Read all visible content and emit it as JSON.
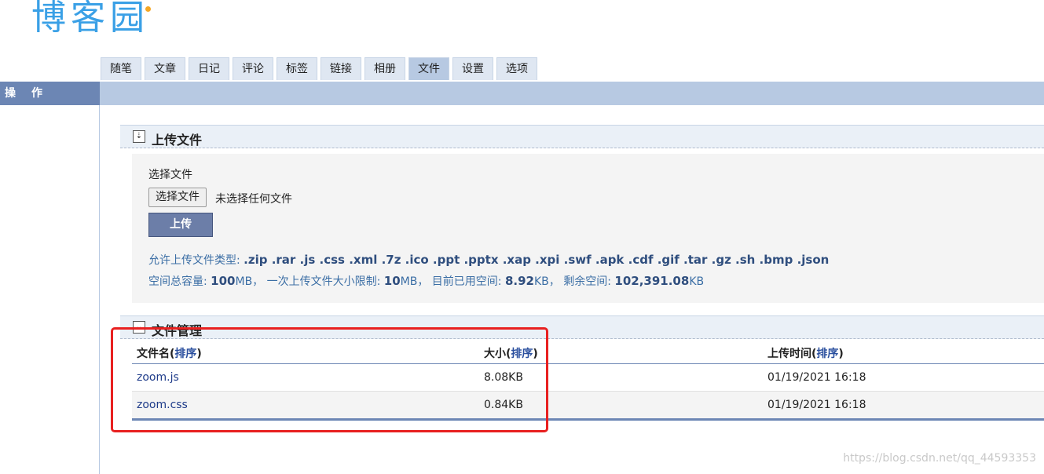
{
  "logo": {
    "text": "博客园"
  },
  "tabs": [
    {
      "label": "随笔"
    },
    {
      "label": "文章"
    },
    {
      "label": "日记"
    },
    {
      "label": "评论"
    },
    {
      "label": "标签"
    },
    {
      "label": "链接"
    },
    {
      "label": "相册"
    },
    {
      "label": "文件"
    },
    {
      "label": "设置"
    },
    {
      "label": "选项"
    }
  ],
  "active_tab": "文件",
  "sidebar": {
    "title": "操作"
  },
  "upload": {
    "section_title": "上传文件",
    "toggle_icon": "double-chevron-down",
    "field_label": "选择文件",
    "choose_button": "选择文件",
    "no_file_text": "未选择任何文件",
    "upload_button": "上传",
    "allowed_prefix": "允许上传文件类型: ",
    "allowed_types": ".zip .rar .js .css .xml .7z .ico .ppt .pptx .xap .xpi .swf .apk .cdf .gif .tar .gz .sh .bmp .json",
    "quota_label": "空间总容量: ",
    "quota_value": "100",
    "quota_unit": "MB， 一次上传文件大小限制: ",
    "limit_value": "10",
    "limit_unit": "MB， 目前已用空间: ",
    "used_value": "8.92",
    "used_unit": "KB， 剩余空间: ",
    "remaining_value": "102,391.08",
    "remaining_unit": "KB"
  },
  "files": {
    "section_title": "文件管理",
    "toggle_icon": "chevron-down",
    "headers": {
      "name": "文件名(",
      "size": "大小(",
      "time": "上传时间(",
      "sort": "排序",
      "close": ")"
    },
    "rows": [
      {
        "name": "zoom.js",
        "size": "8.08KB",
        "time": "01/19/2021 16:18"
      },
      {
        "name": "zoom.css",
        "size": "0.84KB",
        "time": "01/19/2021 16:18"
      }
    ]
  },
  "watermark": "https://blog.csdn.net/qq_44593353",
  "colors": {
    "highlight": "#e82020",
    "accent": "#6c86b4",
    "tab_bg": "#dfe7f2"
  }
}
